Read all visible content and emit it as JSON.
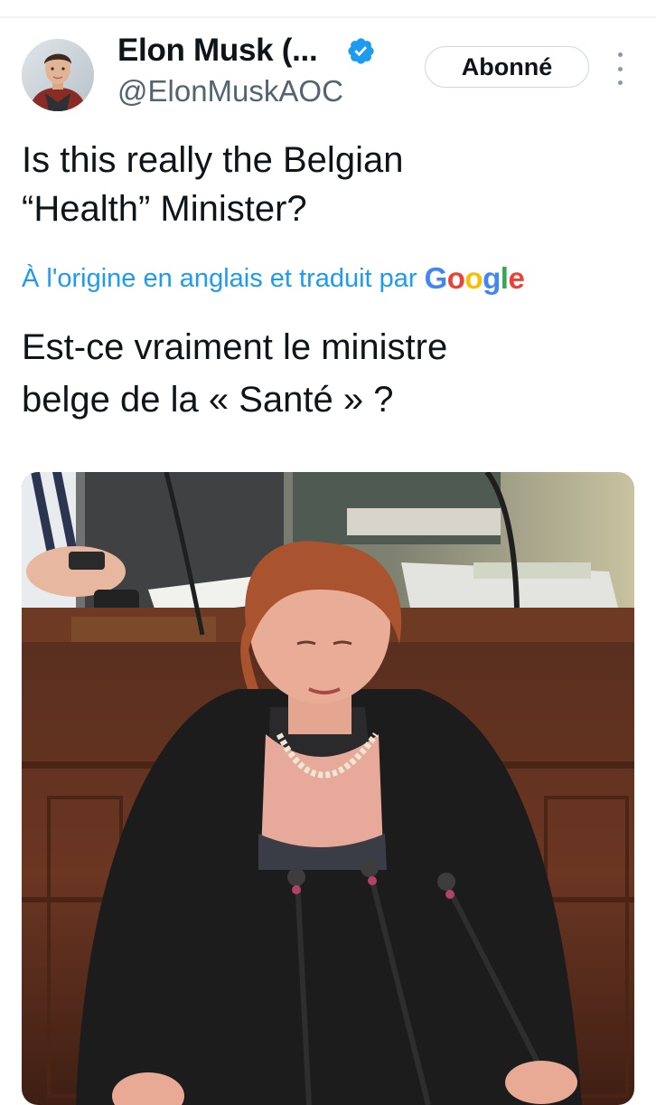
{
  "author": {
    "display_name": "Elon Musk (...",
    "handle": "@ElonMuskAOC",
    "verified": true,
    "avatar_icon": "profile-photo"
  },
  "follow_button": {
    "label": "Abonné"
  },
  "more_menu": {
    "icon": "more-vertical-icon"
  },
  "tweet": {
    "text": "Is this really the Belgian\n“Health” Minister?",
    "translation_label": "À l'origine en anglais et traduit par",
    "translation_provider": "Google",
    "translated_text": "Est-ce vraiment le ministre\nbelge de la « Santé » ?"
  },
  "media": {
    "type": "photo"
  },
  "colors": {
    "accent_blue": "#1d9bf0",
    "secondary_text": "#536471",
    "google_blue": "#4285f4",
    "google_red": "#ea4335",
    "google_yellow": "#fbbc05",
    "google_green": "#34a853"
  }
}
